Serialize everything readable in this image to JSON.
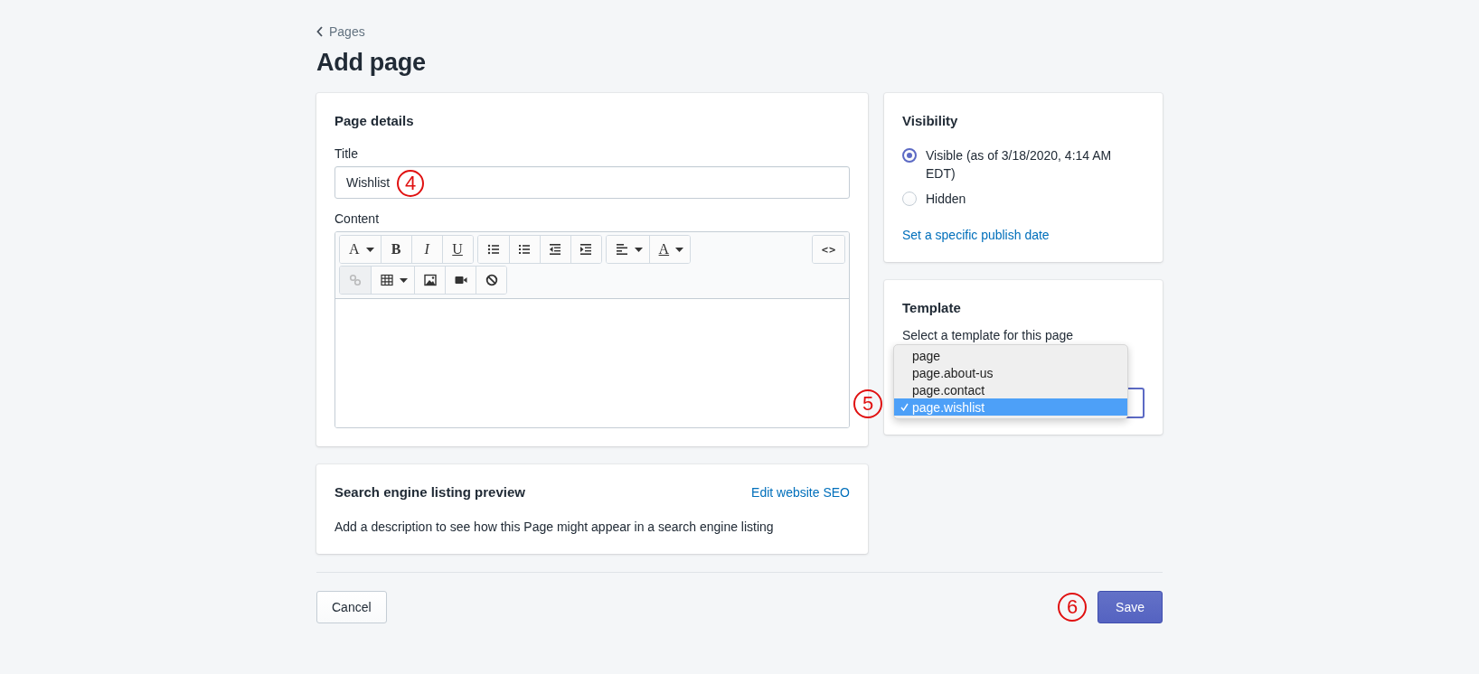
{
  "breadcrumb": {
    "label": "Pages"
  },
  "page_title": "Add page",
  "page_details": {
    "heading": "Page details",
    "title_field": {
      "label": "Title",
      "value": "Wishlist",
      "callout": "4"
    },
    "content": {
      "label": "Content",
      "toolbar_rows": [
        {
          "groups": [
            [
              {
                "kind": "font",
                "glyph": "A",
                "dropdown": true,
                "disabled": false
              },
              {
                "kind": "bold",
                "glyph": "B",
                "dropdown": false,
                "disabled": false
              },
              {
                "kind": "italic",
                "glyph": "I",
                "dropdown": false,
                "disabled": false
              },
              {
                "kind": "underline",
                "glyph": "U",
                "dropdown": false,
                "disabled": false
              }
            ],
            [
              {
                "kind": "bullets",
                "dropdown": false,
                "disabled": false
              },
              {
                "kind": "numbers",
                "dropdown": false,
                "disabled": false
              },
              {
                "kind": "outdent",
                "dropdown": false,
                "disabled": false
              },
              {
                "kind": "indent",
                "dropdown": false,
                "disabled": false
              }
            ],
            [
              {
                "kind": "align",
                "dropdown": true,
                "disabled": false
              },
              {
                "kind": "color",
                "glyph": "A",
                "dropdown": true,
                "disabled": false
              }
            ]
          ],
          "end": {
            "kind": "code",
            "glyph": "<>",
            "dropdown": false,
            "disabled": false
          }
        },
        {
          "groups": [
            [
              {
                "kind": "link",
                "dropdown": false,
                "disabled": true
              },
              {
                "kind": "table",
                "dropdown": true,
                "disabled": false
              },
              {
                "kind": "image",
                "dropdown": false,
                "disabled": false
              },
              {
                "kind": "video",
                "dropdown": false,
                "disabled": false
              },
              {
                "kind": "clear",
                "dropdown": false,
                "disabled": false
              }
            ]
          ]
        }
      ]
    }
  },
  "seo": {
    "heading": "Search engine listing preview",
    "link": "Edit website SEO",
    "description": "Add a description to see how this Page might appear in a search engine listing"
  },
  "visibility": {
    "heading": "Visibility",
    "options": [
      {
        "label": "Visible (as of 3/18/2020, 4:14 AM EDT)",
        "selected": true
      },
      {
        "label": "Hidden",
        "selected": false
      }
    ],
    "link": "Set a specific publish date"
  },
  "template": {
    "heading": "Template",
    "hint": "Select a template for this page",
    "callout": "5",
    "options": [
      {
        "label": "page",
        "selected": false
      },
      {
        "label": "page.about-us",
        "selected": false
      },
      {
        "label": "page.contact",
        "selected": false
      },
      {
        "label": "page.wishlist",
        "selected": true
      }
    ]
  },
  "actions": {
    "cancel": "Cancel",
    "save": "Save",
    "save_callout": "6"
  }
}
